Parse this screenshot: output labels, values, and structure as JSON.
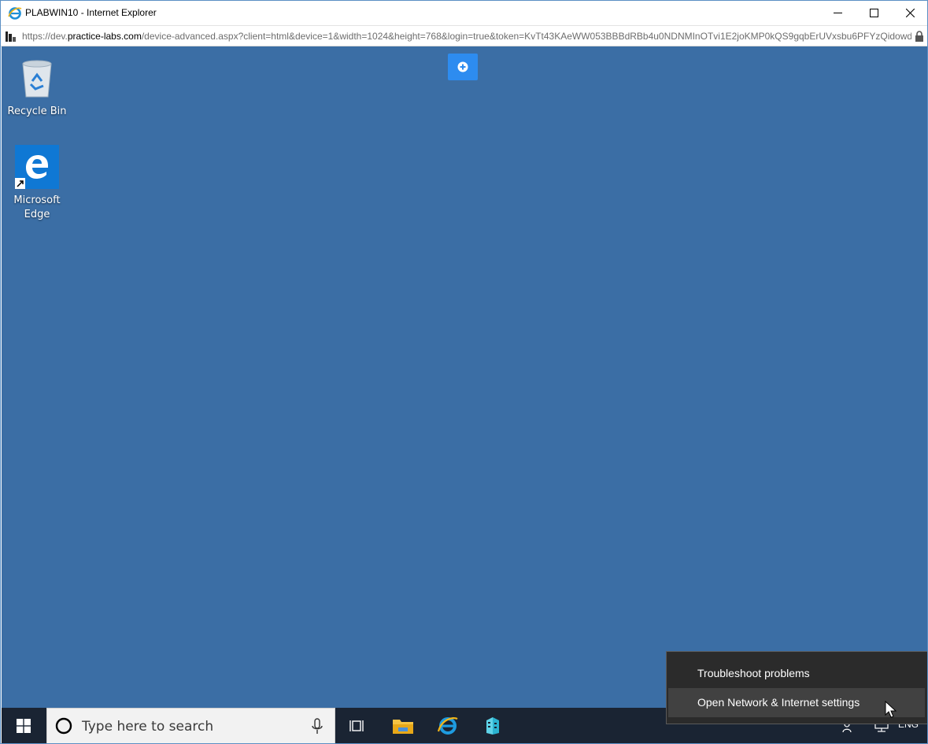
{
  "window": {
    "title": "PLABWIN10 - Internet Explorer",
    "controls": [
      "minimize-icon",
      "maximize-icon",
      "close-icon"
    ]
  },
  "address_bar": {
    "url_prefix": "https://dev.",
    "url_domain": "practice-labs.com",
    "url_rest": "/device-advanced.aspx?client=html&device=1&width=1024&height=768&login=true&token=KvTt43KAeWW053BBBdRBb4u0NDNMInOTvi1E2joKMP0kQS9gqbErUVxsbu6PFYzQidowdX",
    "lock_icon": "lock-icon"
  },
  "desktop": {
    "background": "#3b6ea5",
    "icons": [
      {
        "label": "Recycle Bin",
        "icon": "recycle-bin-icon"
      },
      {
        "label": "Microsoft\nEdge",
        "icon": "microsoft-edge-icon"
      }
    ],
    "remote_toolbar_icon": "plus-circle-icon"
  },
  "context_menu": {
    "items": [
      {
        "label": "Troubleshoot problems"
      },
      {
        "label": "Open Network & Internet settings",
        "highlighted": true
      }
    ]
  },
  "taskbar": {
    "start_icon": "windows-logo-icon",
    "search": {
      "placeholder": "Type here to search"
    },
    "apps": [
      "task-view-icon",
      "file-explorer-icon",
      "internet-explorer-icon",
      "server-manager-icon"
    ],
    "tray_text": "ENG"
  }
}
